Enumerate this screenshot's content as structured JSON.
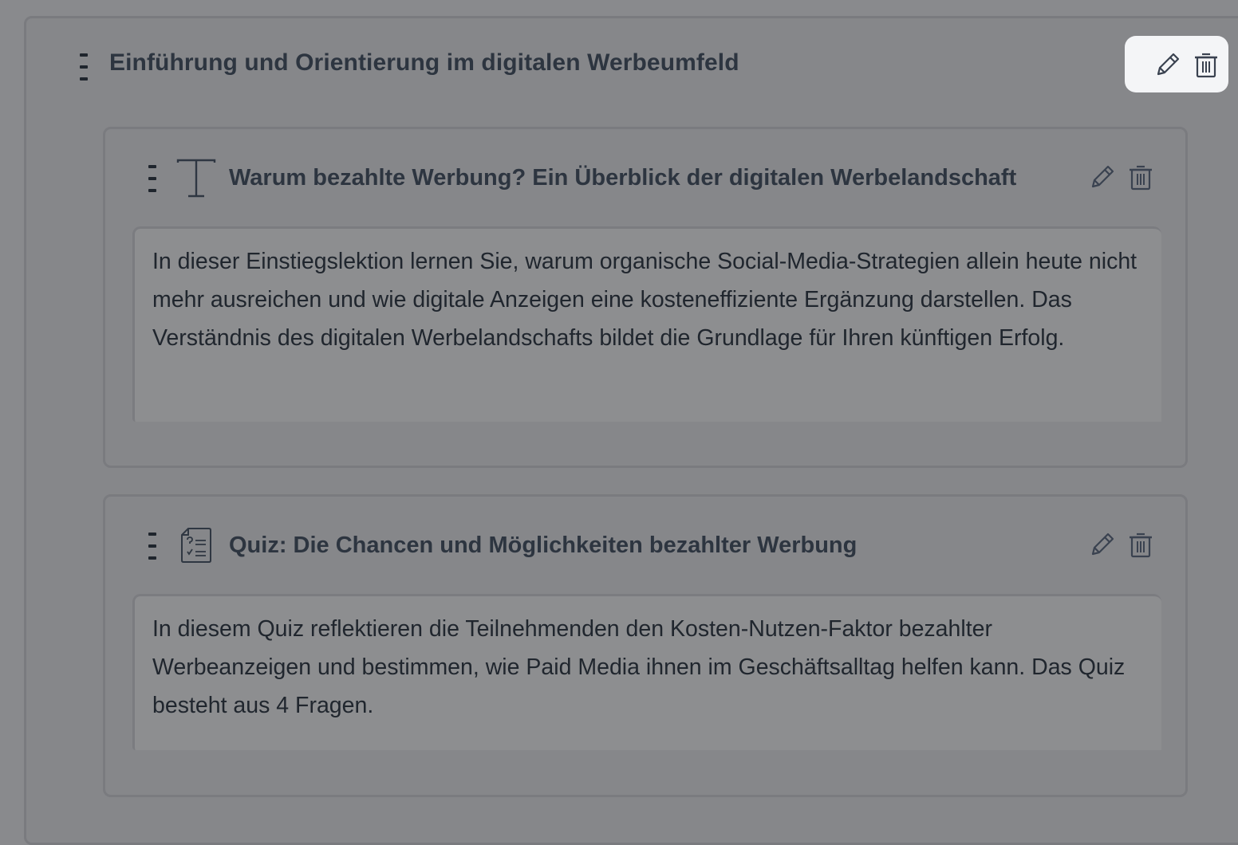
{
  "module": {
    "title": "Einführung und Orientierung im digitalen Werbeumfeld",
    "edit_icon": "pencil-icon",
    "delete_icon": "trash-icon"
  },
  "lessons": [
    {
      "type_icon": "text-type-icon",
      "title": "Warum bezahlte Werbung? Ein Überblick der digitalen Werbelandschaft",
      "description": "In dieser Einstiegslektion lernen Sie, warum organische Social-Media-Strategien allein heute nicht mehr ausreichen und wie digitale Anzeigen eine kosteneffiziente Ergänzung darstellen. Das Verständnis des digitalen Werbelandschafts bildet die Grundlage für Ihren künftigen Erfolg."
    },
    {
      "type_icon": "quiz-document-icon",
      "title": "Quiz: Die Chancen und Möglichkeiten bezahlter Werbung",
      "description": "In diesem Quiz reflektieren die Teilnehmenden den Kosten-Nutzen-Faktor bezahlter Werbeanzeigen und bestimmen, wie Paid Media ihnen im Geschäftsalltag helfen kann. Das Quiz besteht aus 4 Fragen."
    }
  ],
  "colors": {
    "overlay_background": "#898a8d",
    "title_text": "#2d3540",
    "highlight_panel": "#f4f5f7"
  }
}
